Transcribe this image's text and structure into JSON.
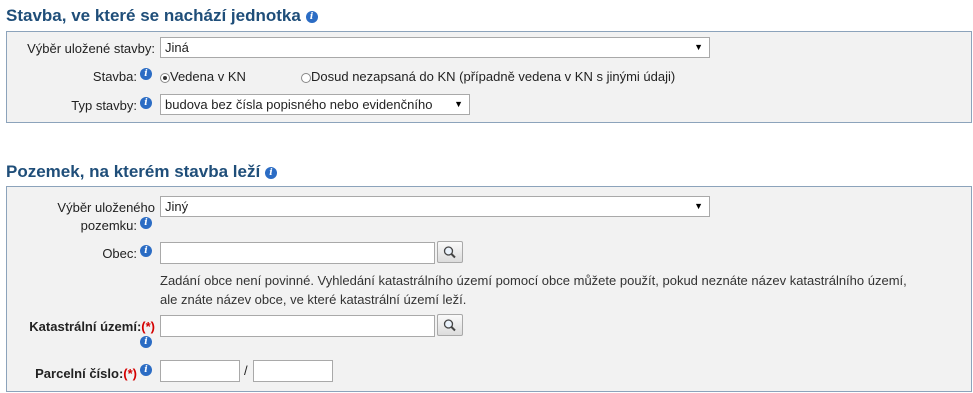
{
  "section1": {
    "title": "Stavba, ve které se nachází jednotka",
    "saved_building_label": "Výběr uložené stavby:",
    "saved_building_value": "Jiná",
    "building_label": "Stavba:",
    "radio_recorded": "Vedena v KN",
    "radio_unrecorded": "Dosud nezapsaná do KN (případně vedena v KN s jinými údaji)",
    "building_type_label": "Typ stavby:",
    "building_type_value": "budova bez čísla popisného nebo evidenčního"
  },
  "section2": {
    "title": "Pozemek, na kterém stavba leží",
    "saved_parcel_label_line1": "Výběr uloženého",
    "saved_parcel_label_line2": "pozemku:",
    "saved_parcel_value": "Jiný",
    "municipality_label": "Obec:",
    "municipality_value": "",
    "hint_line1": "Zadání obce není povinné. Vyhledání katastrálního území pomocí obce můžete použít, pokud neznáte název katastrálního území,",
    "hint_line2": "ale znáte název obce, ve které katastrální území leží.",
    "cadastral_label": "Katastrální území:",
    "required_mark": "(*)",
    "cadastral_value": "",
    "parcel_label": "Parcelní číslo:",
    "parcel_separator": "/",
    "parcel_main": "",
    "parcel_sub": ""
  },
  "icons": {
    "info": "info-icon",
    "search": "magnifier-icon",
    "dropdown": "triangle-down-icon"
  },
  "colors": {
    "title": "#1f4e79",
    "info_icon": "#2b6cc4",
    "required": "#d40000",
    "panel_bg": "#f2f2f2",
    "panel_border": "#8ca3bb"
  }
}
